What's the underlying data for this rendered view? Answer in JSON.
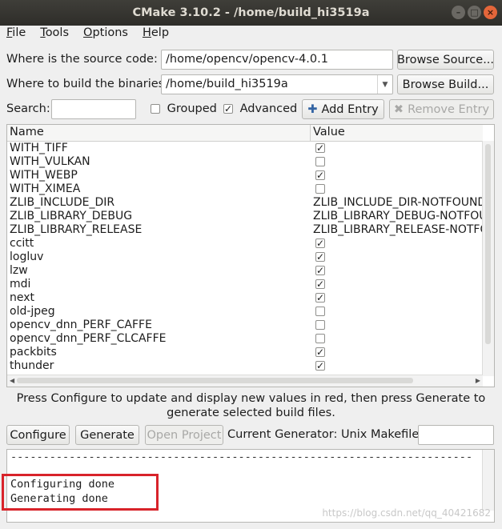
{
  "window": {
    "title": "CMake 3.10.2 - /home/build_hi3519a"
  },
  "menu": [
    {
      "letter": "F",
      "rest": "ile"
    },
    {
      "letter": "T",
      "rest": "ools"
    },
    {
      "letter": "O",
      "rest": "ptions"
    },
    {
      "letter": "H",
      "rest": "elp"
    }
  ],
  "source": {
    "label": "Where is the source code:",
    "value": "/home/opencv/opencv-4.0.1",
    "browse_label": "Browse Source..."
  },
  "build": {
    "label": "Where to build the binaries:",
    "value": "/home/build_hi3519a",
    "browse_label": "Browse Build..."
  },
  "search": {
    "label": "Search:",
    "value": ""
  },
  "options": {
    "grouped_label": "Grouped",
    "grouped_checked": false,
    "advanced_label": "Advanced",
    "advanced_checked": true,
    "add_entry_label": "Add Entry",
    "remove_entry_label": "Remove Entry"
  },
  "table": {
    "col_name": "Name",
    "col_value": "Value",
    "rows": [
      {
        "name": "WITH_TIFF",
        "type": "bool",
        "checked": true
      },
      {
        "name": "WITH_VULKAN",
        "type": "bool",
        "checked": false
      },
      {
        "name": "WITH_WEBP",
        "type": "bool",
        "checked": true
      },
      {
        "name": "WITH_XIMEA",
        "type": "bool",
        "checked": false
      },
      {
        "name": "ZLIB_INCLUDE_DIR",
        "type": "text",
        "value": "ZLIB_INCLUDE_DIR-NOTFOUND"
      },
      {
        "name": "ZLIB_LIBRARY_DEBUG",
        "type": "text",
        "value": "ZLIB_LIBRARY_DEBUG-NOTFOUND"
      },
      {
        "name": "ZLIB_LIBRARY_RELEASE",
        "type": "text",
        "value": "ZLIB_LIBRARY_RELEASE-NOTFOUND"
      },
      {
        "name": "ccitt",
        "type": "bool",
        "checked": true
      },
      {
        "name": "logluv",
        "type": "bool",
        "checked": true
      },
      {
        "name": "lzw",
        "type": "bool",
        "checked": true
      },
      {
        "name": "mdi",
        "type": "bool",
        "checked": true
      },
      {
        "name": "next",
        "type": "bool",
        "checked": true
      },
      {
        "name": "old-jpeg",
        "type": "bool",
        "checked": false
      },
      {
        "name": "opencv_dnn_PERF_CAFFE",
        "type": "bool",
        "checked": false
      },
      {
        "name": "opencv_dnn_PERF_CLCAFFE",
        "type": "bool",
        "checked": false
      },
      {
        "name": "packbits",
        "type": "bool",
        "checked": true
      },
      {
        "name": "thunder",
        "type": "bool",
        "checked": true
      }
    ]
  },
  "info_text": "Press Configure to update and display new values in red, then press Generate to generate selected build files.",
  "actions": {
    "configure_label": "Configure",
    "generate_label": "Generate",
    "open_project_label": "Open Project",
    "generator_label": "Current Generator: Unix Makefiles",
    "generator_field": ""
  },
  "log": {
    "separator": "-----------------------------------------------------------------------",
    "lines": [
      "Configuring done",
      "Generating done"
    ]
  },
  "watermark": "https://blog.csdn.net/qq_40421682",
  "colors": {
    "highlight": "#d8232a",
    "titlebar": "#3f3e39",
    "close_button": "#e4663a"
  }
}
